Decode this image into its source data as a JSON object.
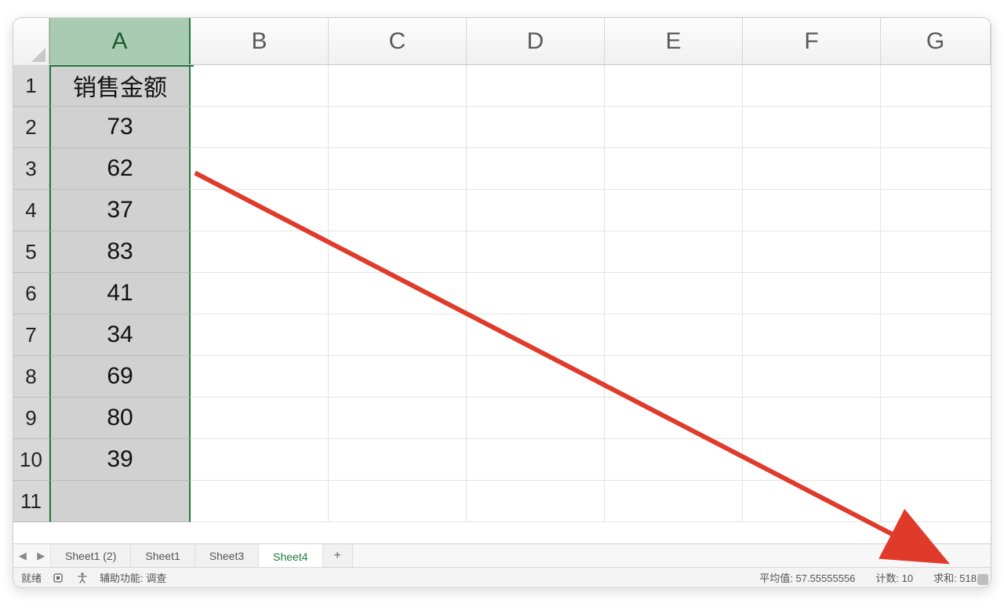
{
  "columns": [
    "A",
    "B",
    "C",
    "D",
    "E",
    "F",
    "G"
  ],
  "selected_column": "A",
  "rows": [
    1,
    2,
    3,
    4,
    5,
    6,
    7,
    8,
    9,
    10,
    11
  ],
  "cells": {
    "A1": "销售金额",
    "A2": "73",
    "A3": "62",
    "A4": "37",
    "A5": "83",
    "A6": "41",
    "A7": "34",
    "A8": "69",
    "A9": "80",
    "A10": "39"
  },
  "tabs": {
    "items": [
      "Sheet1 (2)",
      "Sheet1",
      "Sheet3",
      "Sheet4"
    ],
    "active": "Sheet4",
    "add_label": "+"
  },
  "status": {
    "ready": "就绪",
    "accessibility_label": "辅助功能: 调查",
    "average_label": "平均值: 57.55555556",
    "count_label": "计数: 10",
    "sum_label": "求和: 518"
  },
  "nav": {
    "prev": "◀",
    "next": "▶"
  }
}
